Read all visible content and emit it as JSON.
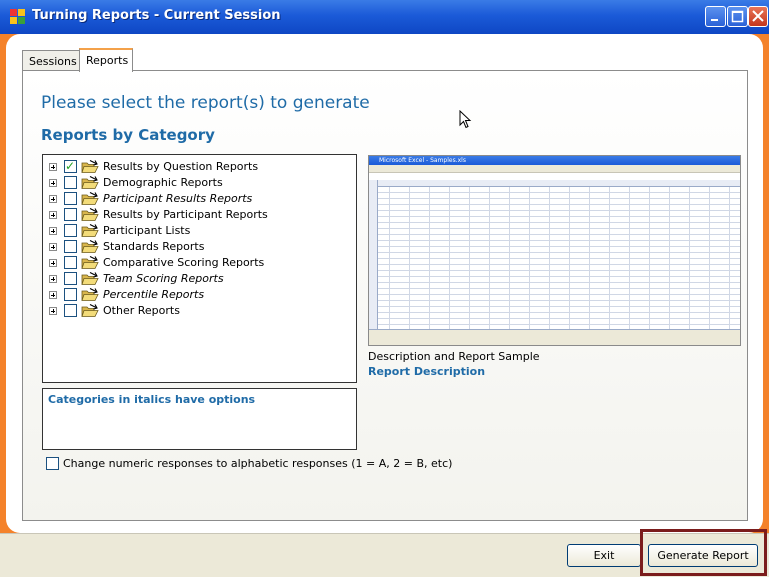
{
  "window": {
    "title": "Turning Reports - Current Session"
  },
  "tabs": [
    {
      "label": "Sessions",
      "selected": false
    },
    {
      "label": "Reports",
      "selected": true
    }
  ],
  "main": {
    "heading": "Please select the report(s) to generate",
    "subheading": "Reports by Category"
  },
  "categories": [
    {
      "label": "Results by Question Reports",
      "checked": true,
      "italic": false
    },
    {
      "label": "Demographic Reports",
      "checked": false,
      "italic": false
    },
    {
      "label": "Participant Results Reports",
      "checked": false,
      "italic": true
    },
    {
      "label": "Results by Participant Reports",
      "checked": false,
      "italic": false
    },
    {
      "label": "Participant Lists",
      "checked": false,
      "italic": false
    },
    {
      "label": "Standards Reports",
      "checked": false,
      "italic": false
    },
    {
      "label": "Comparative Scoring Reports",
      "checked": false,
      "italic": false
    },
    {
      "label": "Team Scoring Reports",
      "checked": false,
      "italic": true
    },
    {
      "label": "Percentile Reports",
      "checked": false,
      "italic": true
    },
    {
      "label": "Other Reports",
      "checked": false,
      "italic": false
    }
  ],
  "description_box": {
    "text": "Categories in italics have options"
  },
  "option": {
    "label": "Change numeric responses to alphabetic responses (1 = A, 2 = B, etc)",
    "checked": false
  },
  "sample": {
    "window_title": "Microsoft Excel - Samples.xls",
    "caption": "Description and Report Sample",
    "link": "Report Description"
  },
  "buttons": {
    "exit": "Exit",
    "generate": "Generate Report"
  },
  "colors": {
    "frame": "#f4822a",
    "heading": "#1f6ba7",
    "highlight": "#7b1c1c"
  }
}
